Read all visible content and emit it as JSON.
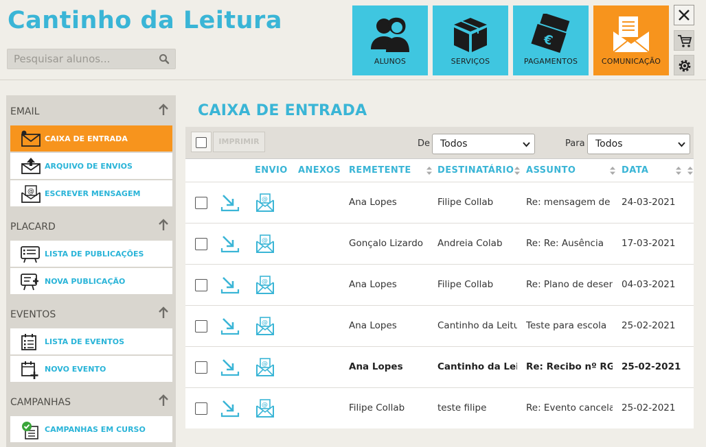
{
  "app": {
    "title": "Cantinho da Leitura"
  },
  "search": {
    "placeholder": "Pesquisar alunos..."
  },
  "nav_tiles": [
    {
      "label": "ALUNOS",
      "icon": "students-icon",
      "active": false
    },
    {
      "label": "SERVIÇOS",
      "icon": "box-icon",
      "active": false
    },
    {
      "label": "PAGAMENTOS",
      "icon": "banknotes-icon",
      "active": false
    },
    {
      "label": "COMUNICAÇÃO",
      "icon": "envelope-icon",
      "active": true
    }
  ],
  "sidebar": {
    "sections": [
      {
        "title": "EMAIL",
        "items": [
          {
            "label": "CAIXA DE ENTRADA",
            "icon": "inbox-icon",
            "active": true
          },
          {
            "label": "ARQUIVO DE ENVIOS",
            "icon": "sent-archive-icon",
            "active": false
          },
          {
            "label": "ESCREVER MENSAGEM",
            "icon": "compose-icon",
            "active": false
          }
        ]
      },
      {
        "title": "PLACARD",
        "items": [
          {
            "label": "LISTA DE PUBLICAÇÕES",
            "icon": "board-list-icon",
            "active": false
          },
          {
            "label": "NOVA PUBLICAÇÃO",
            "icon": "board-new-icon",
            "active": false
          }
        ]
      },
      {
        "title": "EVENTOS",
        "items": [
          {
            "label": "LISTA DE EVENTOS",
            "icon": "calendar-list-icon",
            "active": false
          },
          {
            "label": "NOVO EVENTO",
            "icon": "calendar-add-icon",
            "active": false
          }
        ]
      },
      {
        "title": "CAMPANHAS",
        "items": [
          {
            "label": "CAMPANHAS EM CURSO",
            "icon": "campaign-check-icon",
            "active": false
          }
        ]
      }
    ]
  },
  "main": {
    "title": "CAIXA DE ENTRADA",
    "toolbar": {
      "print_label": "IMPRIMIR",
      "from_label": "De",
      "from_value": "Todos",
      "to_label": "Para",
      "to_value": "Todos"
    },
    "columns": [
      "ENVIO",
      "ANEXOS",
      "REMETENTE",
      "DESTINATÁRIO",
      "ASSUNTO",
      "DATA"
    ],
    "rows": [
      {
        "sender": "Ana Lopes",
        "recipient": "Filipe Collab",
        "subject": "Re: mensagem de teste",
        "date": "24-03-2021",
        "unread": false,
        "attachment": false
      },
      {
        "sender": "Gonçalo Lizardo",
        "recipient": "Andreia Colab",
        "subject": "Re: Re: Ausência",
        "date": "17-03-2021",
        "unread": false,
        "attachment": false
      },
      {
        "sender": "Ana Lopes",
        "recipient": "Filipe Collab",
        "subject": "Re: Plano de desenvolvimento",
        "date": "04-03-2021",
        "unread": false,
        "attachment": false
      },
      {
        "sender": "Ana Lopes",
        "recipient": "Cantinho da Leitura",
        "subject": "Teste para escola",
        "date": "25-02-2021",
        "unread": false,
        "attachment": false
      },
      {
        "sender": "Ana Lopes",
        "recipient": "Cantinho da Leitura",
        "subject": "Re: Recibo nº RG RC",
        "date": "25-02-2021",
        "unread": true,
        "attachment": false
      },
      {
        "sender": "Filipe Collab",
        "recipient": "teste filipe",
        "subject": "Re: Evento cancelado",
        "date": "25-02-2021",
        "unread": false,
        "attachment": false
      }
    ]
  },
  "colors": {
    "accent": "#3ab5d6",
    "tile": "#3fc6e0",
    "active": "#f7941d",
    "background": "#f0eee8",
    "sidebar": "#d9d6cf"
  }
}
